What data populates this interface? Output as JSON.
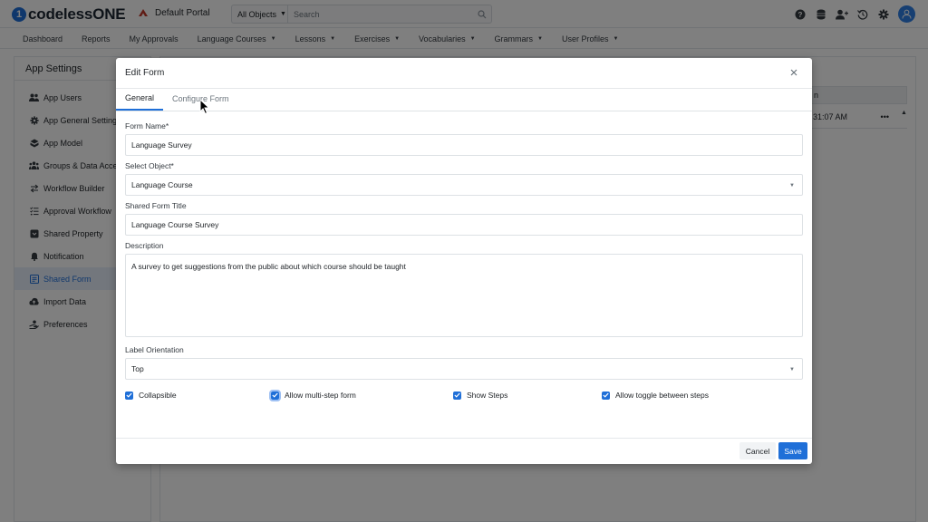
{
  "app": {
    "brand": "codelessONE",
    "brand_mark": "1",
    "portal_name": "Default Portal"
  },
  "search": {
    "object_scope": "All Objects",
    "placeholder": "Search"
  },
  "top_icons": [
    "help-icon",
    "database-icon",
    "user-plus-icon",
    "history-icon",
    "gear-icon",
    "avatar-icon"
  ],
  "nav": {
    "items": [
      {
        "label": "Dashboard",
        "dropdown": false
      },
      {
        "label": "Reports",
        "dropdown": false
      },
      {
        "label": "My Approvals",
        "dropdown": false
      },
      {
        "label": "Language Courses",
        "dropdown": true
      },
      {
        "label": "Lessons",
        "dropdown": true
      },
      {
        "label": "Exercises",
        "dropdown": true
      },
      {
        "label": "Vocabularies",
        "dropdown": true
      },
      {
        "label": "Grammars",
        "dropdown": true
      },
      {
        "label": "User Profiles",
        "dropdown": true
      }
    ]
  },
  "sidebar": {
    "title": "App Settings",
    "items": [
      {
        "label": "App Users",
        "icon": "users-icon",
        "active": false
      },
      {
        "label": "App General Settings",
        "icon": "gear-icon",
        "active": false
      },
      {
        "label": "App Model",
        "icon": "model-icon",
        "active": false
      },
      {
        "label": "Groups & Data Access",
        "icon": "groups-icon",
        "active": false
      },
      {
        "label": "Workflow Builder",
        "icon": "workflow-icon",
        "active": false
      },
      {
        "label": "Approval Workflow",
        "icon": "approval-icon",
        "active": false
      },
      {
        "label": "Shared Property",
        "icon": "property-icon",
        "active": false
      },
      {
        "label": "Notification",
        "icon": "bell-icon",
        "active": false
      },
      {
        "label": "Shared Form",
        "icon": "form-icon",
        "active": true
      },
      {
        "label": "Import Data",
        "icon": "upload-icon",
        "active": false
      },
      {
        "label": "Preferences",
        "icon": "preferences-icon",
        "active": false
      }
    ]
  },
  "background_grid": {
    "header_fragment": "n",
    "cell_fragment": "31:07 AM",
    "row_menu": "•••"
  },
  "modal": {
    "title": "Edit Form",
    "tabs": [
      {
        "label": "General",
        "active": true
      },
      {
        "label": "Configure Form",
        "active": false
      }
    ],
    "fields": {
      "form_name": {
        "label": "Form Name*",
        "value": "Language Survey"
      },
      "select_object": {
        "label": "Select Object*",
        "value": "Language Course"
      },
      "shared_form_title": {
        "label": "Shared Form Title",
        "value": "Language Course Survey"
      },
      "description": {
        "label": "Description",
        "value": "A survey to get suggestions from the public about which course should be taught"
      },
      "label_orientation": {
        "label": "Label Orientation",
        "value": "Top"
      }
    },
    "checkboxes": [
      {
        "label": "Collapsible",
        "checked": true,
        "focused": false
      },
      {
        "label": "Allow multi-step form",
        "checked": true,
        "focused": true
      },
      {
        "label": "Show Steps",
        "checked": true,
        "focused": false
      },
      {
        "label": "Allow toggle between steps",
        "checked": true,
        "focused": false
      }
    ],
    "buttons": {
      "cancel": "Cancel",
      "save": "Save"
    }
  },
  "colors": {
    "accent": "#1f6fd8",
    "overlay": "rgba(0,0,0,0.5)",
    "active_sidebar_bg": "#e7effa"
  }
}
